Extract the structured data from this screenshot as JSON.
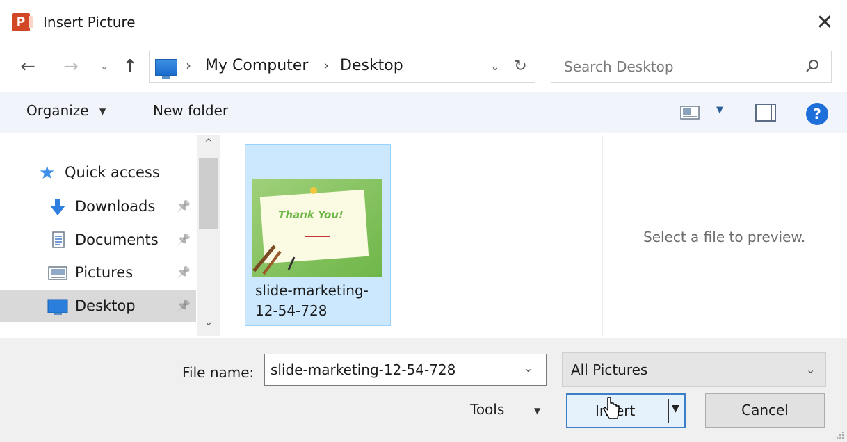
{
  "window": {
    "title": "Insert Picture",
    "app_icon_letter": "P",
    "close_glyph": "✕"
  },
  "nav": {
    "back_glyph": "←",
    "forward_glyph": "→",
    "recent_glyph": "⌄",
    "up_glyph": "↑"
  },
  "address": {
    "separator": "›",
    "crumbs": [
      "My Computer",
      "Desktop"
    ],
    "dropdown_glyph": "⌄",
    "refresh_glyph": "↻"
  },
  "search": {
    "placeholder": "Search Desktop"
  },
  "toolbar": {
    "organize_label": "Organize",
    "dropdown_glyph": "▼",
    "new_folder_label": "New folder",
    "help_glyph": "?"
  },
  "sidebar": {
    "items": [
      {
        "label": "Quick access",
        "icon": "star-icon"
      },
      {
        "label": "Downloads",
        "icon": "download-arrow-icon",
        "pinned": true
      },
      {
        "label": "Documents",
        "icon": "document-icon",
        "pinned": true
      },
      {
        "label": "Pictures",
        "icon": "pictures-icon",
        "pinned": true
      },
      {
        "label": "Desktop",
        "icon": "desktop-icon",
        "pinned": true,
        "selected": true
      }
    ],
    "pin_glyph": "📌",
    "scroll_up_glyph": "^",
    "scroll_down_glyph": "⌄"
  },
  "files": [
    {
      "name": "slide-marketing-12-54-728",
      "name_display": "slide-marketing-\n12-54-728",
      "selected": true,
      "thumbnail_text": "Thank You!"
    }
  ],
  "preview": {
    "message": "Select a file to preview."
  },
  "footer": {
    "file_name_label": "File name:",
    "file_name_value": "slide-marketing-12-54-728",
    "file_type_value": "All Pictures",
    "tools_label": "Tools",
    "insert_label": "Insert",
    "cancel_label": "Cancel",
    "dropdown_glyph": "⌄"
  },
  "colors": {
    "accent": "#1e6fd9",
    "selection": "#cce8ff",
    "office_orange": "#d24726"
  }
}
